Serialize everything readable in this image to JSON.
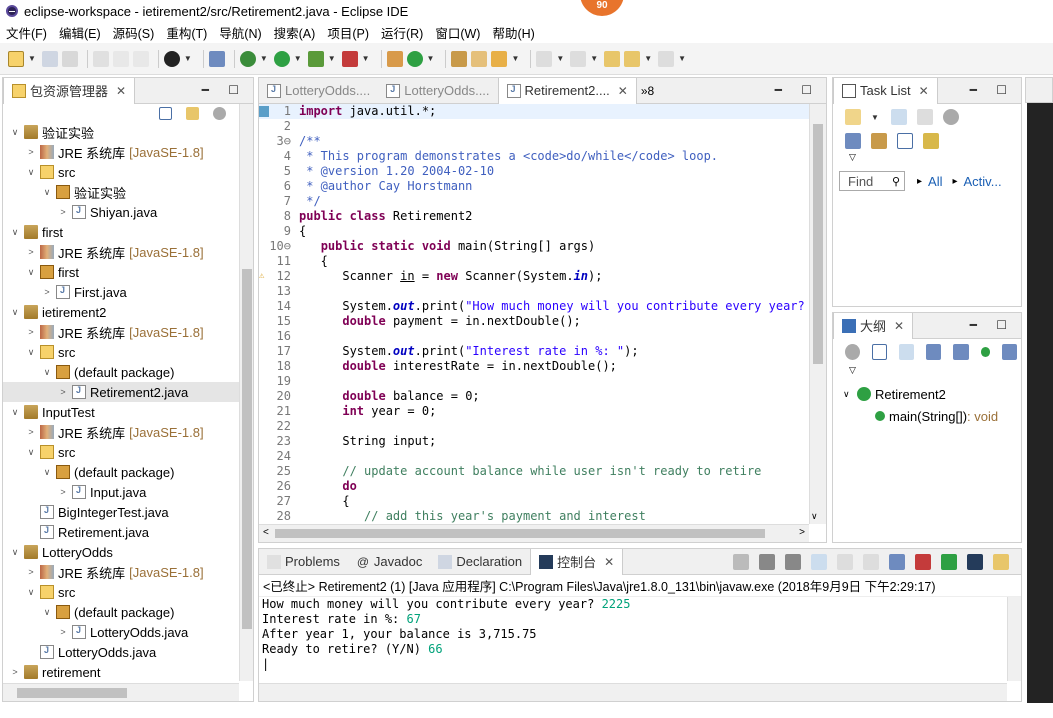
{
  "window": {
    "title": "eclipse-workspace - ietirement2/src/Retirement2.java - Eclipse IDE",
    "badge": "90"
  },
  "menu": [
    "文件(F)",
    "编辑(E)",
    "源码(S)",
    "重构(T)",
    "导航(N)",
    "搜索(A)",
    "项目(P)",
    "运行(R)",
    "窗口(W)",
    "帮助(H)"
  ],
  "explorer": {
    "title": "包资源管理器",
    "items": [
      {
        "label": "验证实验",
        "lib": "",
        "level": 0,
        "arrow": "∨",
        "icon": "proj"
      },
      {
        "label": "JRE 系统库",
        "lib": "[JavaSE-1.8]",
        "level": 1,
        "arrow": ">",
        "icon": "jre"
      },
      {
        "label": "src",
        "lib": "",
        "level": 1,
        "arrow": "∨",
        "icon": "pkgf"
      },
      {
        "label": "验证实验",
        "lib": "",
        "level": 2,
        "arrow": "∨",
        "icon": "pkg"
      },
      {
        "label": "Shiyan.java",
        "lib": "",
        "level": 3,
        "arrow": ">",
        "icon": "jfile"
      },
      {
        "label": "first",
        "lib": "",
        "level": 0,
        "arrow": "∨",
        "icon": "proj"
      },
      {
        "label": "JRE 系统库",
        "lib": "[JavaSE-1.8]",
        "level": 1,
        "arrow": ">",
        "icon": "jre"
      },
      {
        "label": "first",
        "lib": "",
        "level": 1,
        "arrow": "∨",
        "icon": "pkg"
      },
      {
        "label": "First.java",
        "lib": "",
        "level": 2,
        "arrow": ">",
        "icon": "jfile"
      },
      {
        "label": "ietirement2",
        "lib": "",
        "level": 0,
        "arrow": "∨",
        "icon": "proj"
      },
      {
        "label": "JRE 系统库",
        "lib": "[JavaSE-1.8]",
        "level": 1,
        "arrow": ">",
        "icon": "jre"
      },
      {
        "label": "src",
        "lib": "",
        "level": 1,
        "arrow": "∨",
        "icon": "pkgf"
      },
      {
        "label": "(default package)",
        "lib": "",
        "level": 2,
        "arrow": "∨",
        "icon": "pkg"
      },
      {
        "label": "Retirement2.java",
        "lib": "",
        "level": 3,
        "arrow": ">",
        "icon": "jfile",
        "selected": true
      },
      {
        "label": "InputTest",
        "lib": "",
        "level": 0,
        "arrow": "∨",
        "icon": "proj"
      },
      {
        "label": "JRE 系统库",
        "lib": "[JavaSE-1.8]",
        "level": 1,
        "arrow": ">",
        "icon": "jre"
      },
      {
        "label": "src",
        "lib": "",
        "level": 1,
        "arrow": "∨",
        "icon": "pkgf"
      },
      {
        "label": "(default package)",
        "lib": "",
        "level": 2,
        "arrow": "∨",
        "icon": "pkg"
      },
      {
        "label": "Input.java",
        "lib": "",
        "level": 3,
        "arrow": ">",
        "icon": "jfile"
      },
      {
        "label": "BigIntegerTest.java",
        "lib": "",
        "level": 1,
        "arrow": "",
        "icon": "jfile"
      },
      {
        "label": "Retirement.java",
        "lib": "",
        "level": 1,
        "arrow": "",
        "icon": "jfile"
      },
      {
        "label": "LotteryOdds",
        "lib": "",
        "level": 0,
        "arrow": "∨",
        "icon": "proj"
      },
      {
        "label": "JRE 系统库",
        "lib": "[JavaSE-1.8]",
        "level": 1,
        "arrow": ">",
        "icon": "jre"
      },
      {
        "label": "src",
        "lib": "",
        "level": 1,
        "arrow": "∨",
        "icon": "pkgf"
      },
      {
        "label": "(default package)",
        "lib": "",
        "level": 2,
        "arrow": "∨",
        "icon": "pkg"
      },
      {
        "label": "LotteryOdds.java",
        "lib": "",
        "level": 3,
        "arrow": ">",
        "icon": "jfile"
      },
      {
        "label": "LotteryOdds.java",
        "lib": "",
        "level": 1,
        "arrow": "",
        "icon": "jfile"
      },
      {
        "label": "retirement",
        "lib": "",
        "level": 0,
        "arrow": ">",
        "icon": "proj"
      }
    ]
  },
  "editor": {
    "tabs": [
      "LotteryOdds....",
      "LotteryOdds....",
      "Retirement2...."
    ],
    "overflow": "»8",
    "lines": [
      {
        "n": "1",
        "html": "<span class='kw'>import</span> java.util.*;"
      },
      {
        "n": "2",
        "html": ""
      },
      {
        "n": "3⊖",
        "html": "<span class='jd'>/**</span>"
      },
      {
        "n": "4",
        "html": "<span class='jd'> * This program demonstrates a &lt;code&gt;do/while&lt;/code&gt; loop.</span>"
      },
      {
        "n": "5",
        "html": "<span class='jd'> * @version 1.20 2004-02-10</span>"
      },
      {
        "n": "6",
        "html": "<span class='jd'> * @author Cay Horstmann</span>"
      },
      {
        "n": "7",
        "html": "<span class='jd'> */</span>"
      },
      {
        "n": "8",
        "html": "<span class='kw'>public class</span> Retirement2"
      },
      {
        "n": "9",
        "html": "{"
      },
      {
        "n": "10⊖",
        "html": "   <span class='kw'>public static void</span> main(String[] args)"
      },
      {
        "n": "11",
        "html": "   {"
      },
      {
        "n": "12",
        "html": "      Scanner <u>in</u> = <span class='kw'>new</span> Scanner(System.<span class='sf'>in</span>);"
      },
      {
        "n": "13",
        "html": ""
      },
      {
        "n": "14",
        "html": "      System.<span class='sf'>out</span>.print(<span class='st'>\"How much money will you contribute every year?</span>"
      },
      {
        "n": "15",
        "html": "      <span class='kw'>double</span> payment = in.nextDouble();"
      },
      {
        "n": "16",
        "html": ""
      },
      {
        "n": "17",
        "html": "      System.<span class='sf'>out</span>.print(<span class='st'>\"Interest rate in %: \"</span>);"
      },
      {
        "n": "18",
        "html": "      <span class='kw'>double</span> interestRate = in.nextDouble();"
      },
      {
        "n": "19",
        "html": ""
      },
      {
        "n": "20",
        "html": "      <span class='kw'>double</span> balance = 0;"
      },
      {
        "n": "21",
        "html": "      <span class='kw'>int</span> year = 0;"
      },
      {
        "n": "22",
        "html": ""
      },
      {
        "n": "23",
        "html": "      String input;"
      },
      {
        "n": "24",
        "html": ""
      },
      {
        "n": "25",
        "html": "      <span class='cm'>// update account balance while user isn't ready to retire</span>"
      },
      {
        "n": "26",
        "html": "      <span class='kw'>do</span>"
      },
      {
        "n": "27",
        "html": "      {"
      },
      {
        "n": "28",
        "html": "         <span class='cm'>// add this year's payment and interest</span>"
      }
    ]
  },
  "tasklist": {
    "title": "Task List",
    "find_placeholder": "Find",
    "all": "All",
    "activ": "Activ..."
  },
  "outline": {
    "title": "大纲",
    "class_name": "Retirement2",
    "method": "main(String[])",
    "method_type": " : void"
  },
  "bottom": {
    "tabs": [
      "Problems",
      "Javadoc",
      "Declaration",
      "控制台"
    ],
    "terminated": "<已终止> Retirement2 (1)  [Java 应用程序] C:\\Program Files\\Java\\jre1.8.0_131\\bin\\javaw.exe  (2018年9月9日 下午2:29:17)",
    "console": [
      {
        "text": "How much money will you contribute every year? ",
        "input": "2225"
      },
      {
        "text": "Interest rate in %: ",
        "input": "67"
      },
      {
        "text": "After year 1, your balance is 3,715.75",
        "input": ""
      },
      {
        "text": "Ready to retire? (Y/N) ",
        "input": "66"
      }
    ]
  }
}
